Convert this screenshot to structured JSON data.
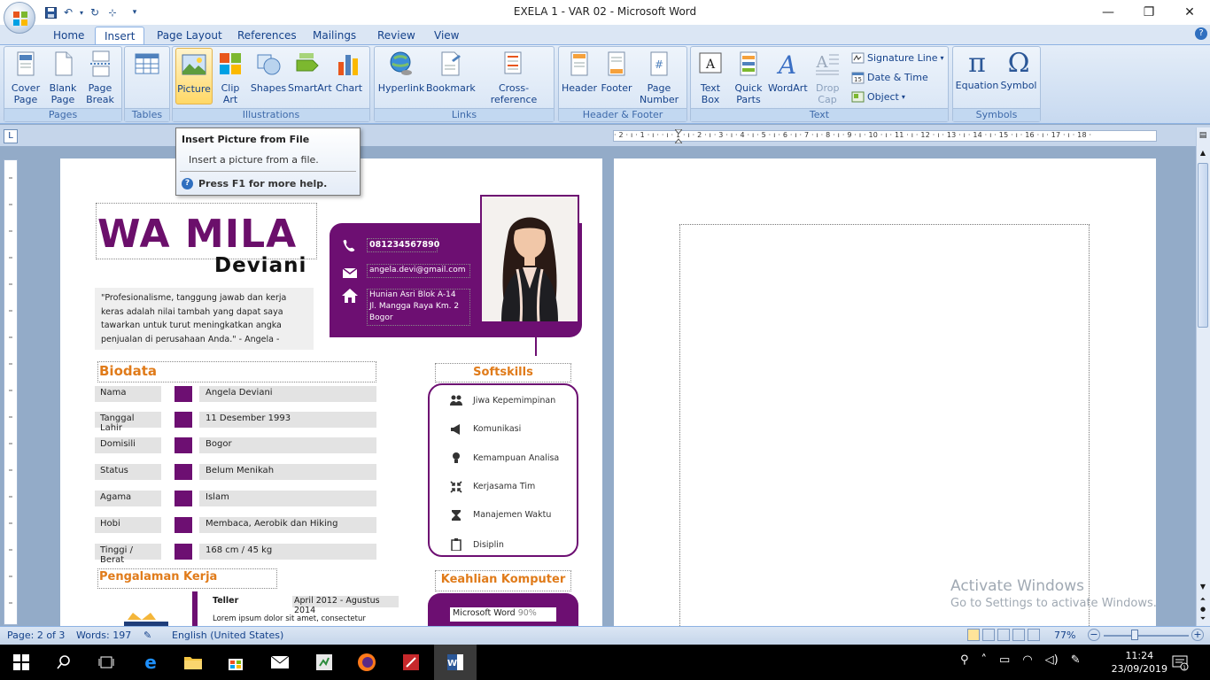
{
  "window": {
    "title": "EXELA 1 - VAR 02 - Microsoft Word"
  },
  "qat": {
    "save": "save-icon",
    "undo": "undo-icon",
    "redo": "redo-icon"
  },
  "tabs": [
    "Home",
    "Insert",
    "Page Layout",
    "References",
    "Mailings",
    "Review",
    "View"
  ],
  "active_tab": "Insert",
  "ribbon": {
    "pages": {
      "label": "Pages",
      "cover": "Cover Page",
      "cover_dd": "▾",
      "blank": "Blank Page",
      "break": "Page Break"
    },
    "tables": {
      "label": "Tables",
      "table": "Table"
    },
    "illustrations": {
      "label": "Illustrations",
      "picture": "Picture",
      "clipart": "Clip Art",
      "shapes": "Shapes",
      "smartart": "SmartArt",
      "chart": "Chart"
    },
    "links": {
      "label": "Links",
      "hyperlink": "Hyperlink",
      "bookmark": "Bookmark",
      "crossref": "Cross-reference"
    },
    "hf": {
      "label": "Header & Footer",
      "header": "Header",
      "footer": "Footer",
      "pagenum": "Page Number"
    },
    "text": {
      "label": "Text",
      "textbox": "Text Box",
      "quickparts": "Quick Parts",
      "wordart": "WordArt",
      "dropcap": "Drop Cap",
      "sigline": "Signature Line",
      "datetime": "Date & Time",
      "object": "Object"
    },
    "symbols": {
      "label": "Symbols",
      "equation": "Equation",
      "symbol": "Symbol"
    }
  },
  "tooltip": {
    "title": "Insert Picture from File",
    "desc": "Insert a picture from a file.",
    "help": "Press F1 for more help."
  },
  "ruler": {
    "ticks": "· 2 · ı · 1 · ı ·   · ı · 1 · ı · 2 · ı · 3 · ı · 4 · ı · 5 · ı · 6 · ı · 7 · ı · 8 · ı · 9 · ı · 10 · ı · 11 · ı · 12 · ı · 13 · ı · 14 · ı · 15 · ı · 16 · ı · 17 · ı · 18 ·"
  },
  "cv": {
    "name": "WA MILA",
    "surname": "Deviani",
    "quote": "\"Profesionalisme, tanggung jawab dan kerja keras adalah nilai tambah yang dapat saya tawarkan untuk turut meningkatkan angka penjualan di perusahaan Anda.\" - Angela -",
    "phone": "081234567890",
    "email": "angela.devi@gmail.com",
    "address1": "Hunian Asri Blok A-14",
    "address2": "Jl. Mangga Raya Km. 2",
    "address3": "Bogor",
    "biodata_title": "Biodata",
    "biodata": [
      {
        "label": "Nama",
        "value": "Angela Deviani"
      },
      {
        "label": "Tanggal Lahir",
        "value": "11 Desember 1993"
      },
      {
        "label": "Domisili",
        "value": "Bogor"
      },
      {
        "label": "Status",
        "value": "Belum Menikah"
      },
      {
        "label": "Agama",
        "value": "Islam"
      },
      {
        "label": "Hobi",
        "value": "Membaca, Aerobik dan Hiking"
      },
      {
        "label": "Tinggi / Berat",
        "value": "168 cm / 45 kg"
      }
    ],
    "softskills_title": "Softskills",
    "softskills": [
      "Jiwa Kepemimpinan",
      "Komunikasi",
      "Kemampuan Analisa",
      "Kerjasama Tim",
      "Manajemen Waktu",
      "Disiplin"
    ],
    "experience_title": "Pengalaman Kerja",
    "job_title": "Teller",
    "job_period": "April 2012 - Agustus 2014",
    "job_desc": "Lorem ipsum dolor sit amet, consectetur",
    "computer_title": "Keahlian Komputer",
    "computer_item": "Microsoft Word",
    "computer_pct": "90%"
  },
  "status": {
    "page": "Page: 2 of 3",
    "words": "Words: 197",
    "lang": "English (United States)",
    "zoom": "77%"
  },
  "activate": {
    "line1": "Activate Windows",
    "line2": "Go to Settings to activate Windows."
  },
  "clock": {
    "time": "11:24",
    "date": "23/09/2019"
  },
  "colors": {
    "accent": "#6d0f72",
    "orange": "#e07b1a",
    "ribbon": "#dbe7f6"
  }
}
